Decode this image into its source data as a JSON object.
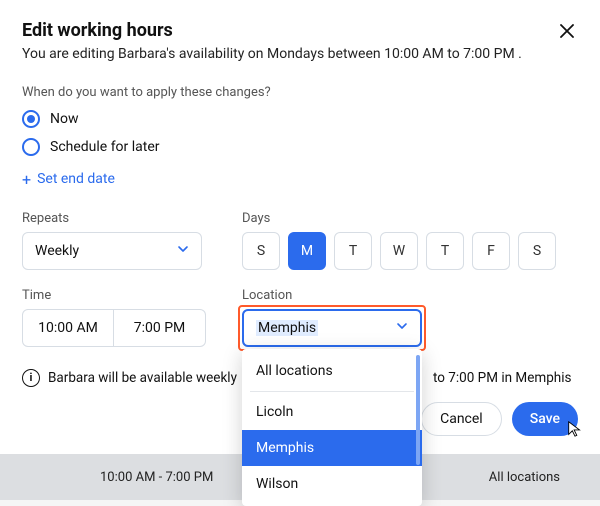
{
  "header": {
    "title": "Edit working hours",
    "subtitle": "You are editing Barbara's availability on Mondays between 10:00 AM to 7:00 PM ."
  },
  "apply": {
    "question": "When do you want to apply these changes?",
    "now": "Now",
    "later": "Schedule for later"
  },
  "end_date": {
    "label": "Set end date"
  },
  "repeats": {
    "label": "Repeats",
    "value": "Weekly"
  },
  "days_section": {
    "label": "Days",
    "days": [
      "S",
      "M",
      "T",
      "W",
      "T",
      "F",
      "S"
    ],
    "selected_index": 1
  },
  "time": {
    "label": "Time",
    "start": "10:00 AM",
    "end": "7:00 PM"
  },
  "location": {
    "label": "Location",
    "value": "Memphis",
    "options": {
      "all": "All locations",
      "o1": "Licoln",
      "o2": "Memphis",
      "o3": "Wilson"
    }
  },
  "info": {
    "text_left": "Barbara will be available weekly",
    "text_right": "to 7:00 PM in Memphis"
  },
  "actions": {
    "cancel": "Cancel",
    "save": "Save"
  },
  "footer": {
    "left": "10:00 AM - 7:00 PM",
    "right": "All locations"
  }
}
